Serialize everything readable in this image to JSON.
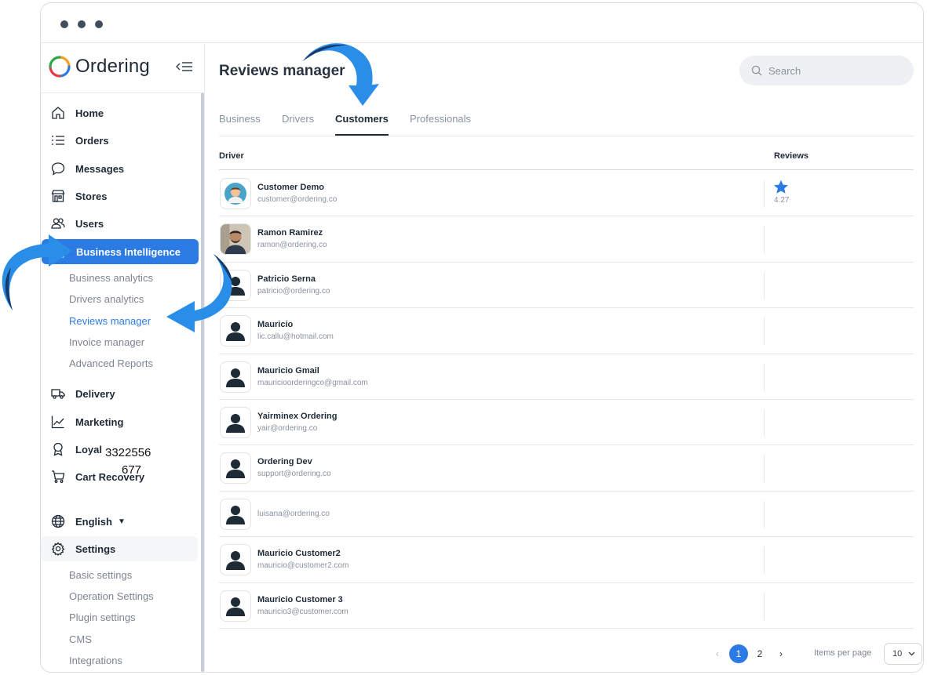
{
  "window": {
    "controls": [
      "close",
      "minimize",
      "maximize"
    ]
  },
  "brand": {
    "name": "Ordering",
    "logo_colors": [
      "#e63946",
      "#f4a020",
      "#2ca84a",
      "#2c7be5"
    ]
  },
  "sidebar": {
    "items": [
      {
        "label": "Home",
        "icon": "home-icon"
      },
      {
        "label": "Orders",
        "icon": "list-icon"
      },
      {
        "label": "Messages",
        "icon": "chat-icon"
      },
      {
        "label": "Stores",
        "icon": "store-icon"
      },
      {
        "label": "Users",
        "icon": "users-icon"
      },
      {
        "label": "Business Intelligence",
        "icon": "chart-icon",
        "active": true
      },
      {
        "label": "Delivery",
        "icon": "truck-icon"
      },
      {
        "label": "Marketing",
        "icon": "trend-icon"
      },
      {
        "label": "Loyal",
        "icon": "award-icon"
      },
      {
        "label": "Cart Recovery",
        "icon": "cart-icon"
      }
    ],
    "bi_subitems": [
      "Business analytics",
      "Drivers analytics",
      "Reviews manager",
      "Invoice manager",
      "Advanced Reports"
    ],
    "language": {
      "label": "English",
      "icon": "globe-icon"
    },
    "settings": {
      "label": "Settings",
      "icon": "gear-icon"
    },
    "settings_subitems": [
      "Basic settings",
      "Operation Settings",
      "Plugin settings",
      "CMS",
      "Integrations"
    ]
  },
  "overlay_text": {
    "line1": "3322556",
    "line2": "677"
  },
  "header": {
    "title": "Reviews manager",
    "search_placeholder": "Search"
  },
  "tabs": [
    {
      "label": "Business"
    },
    {
      "label": "Drivers"
    },
    {
      "label": "Customers",
      "active": true
    },
    {
      "label": "Professionals"
    }
  ],
  "table": {
    "columns": [
      "Driver",
      "Reviews"
    ],
    "rows": [
      {
        "name": "Customer Demo",
        "email": "customer@ordering.co",
        "rating": "4.27",
        "avatar": "cartoon"
      },
      {
        "name": "Ramon Ramirez",
        "email": "ramon@ordering.co",
        "rating": "",
        "avatar": "photo"
      },
      {
        "name": "Patricio Serna",
        "email": "patricio@ordering.co",
        "rating": "",
        "avatar": "default"
      },
      {
        "name": "Mauricio",
        "email": "lic.callu@hotmail.com",
        "rating": "",
        "avatar": "default"
      },
      {
        "name": "Mauricio Gmail",
        "email": "mauricioorderingco@gmail.com",
        "rating": "",
        "avatar": "default"
      },
      {
        "name": "Yairminex Ordering",
        "email": "yair@ordering.co",
        "rating": "",
        "avatar": "default"
      },
      {
        "name": "Ordering Dev",
        "email": "support@ordering.co",
        "rating": "",
        "avatar": "default"
      },
      {
        "name": "",
        "email": "luisana@ordering.co",
        "rating": "",
        "avatar": "default"
      },
      {
        "name": "Mauricio Customer2",
        "email": "mauricio@customer2.com",
        "rating": "",
        "avatar": "default"
      },
      {
        "name": "Mauricio Customer 3",
        "email": "mauricio3@customer.com",
        "rating": "",
        "avatar": "default"
      }
    ]
  },
  "pagination": {
    "pages": [
      "1",
      "2"
    ],
    "current": "1",
    "items_per_page_label": "Items per page",
    "items_per_page": "10"
  },
  "colors": {
    "accent": "#2c7be5",
    "annotation_arrow": "#2a8ee8",
    "text_dark": "#1f2a37",
    "text_muted": "#8a929e"
  }
}
